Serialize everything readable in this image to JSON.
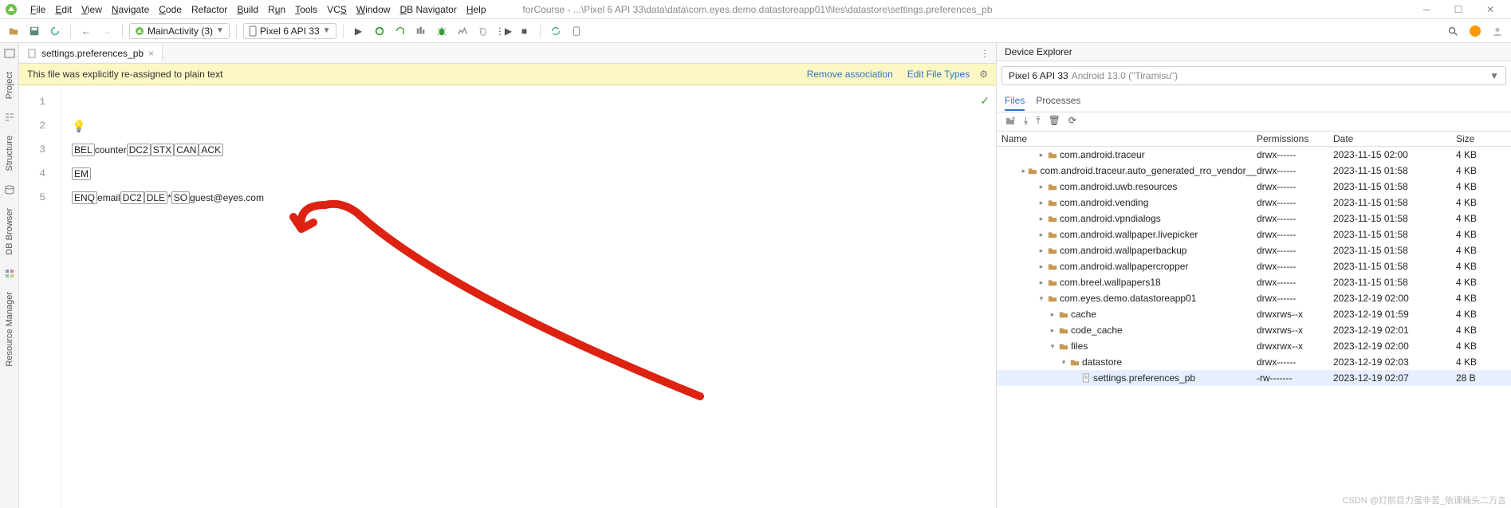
{
  "window": {
    "title_path": "forCourse - ...\\Pixel 6 API 33\\data\\data\\com.eyes.demo.datastoreapp01\\files\\datastore\\settings.preferences_pb"
  },
  "menu": {
    "file": "File",
    "edit": "Edit",
    "view": "View",
    "navigate": "Navigate",
    "code": "Code",
    "refactor": "Refactor",
    "build": "Build",
    "run": "Run",
    "tools": "Tools",
    "vcs": "VCS",
    "window": "Window",
    "dbnav": "DB Navigator",
    "help": "Help"
  },
  "toolbar": {
    "config": "MainActivity (3)",
    "device": "Pixel 6 API 33"
  },
  "left_tabs": [
    "Project",
    "Structure",
    "DB Browser",
    "Resource Manager"
  ],
  "editor": {
    "tab": "settings.preferences_pb",
    "banner_msg": "This file was explicitly re-assigned to plain text",
    "banner_remove": "Remove association",
    "banner_edit": "Edit File Types",
    "lines": [
      "1",
      "2",
      "3",
      "4",
      "5"
    ],
    "l3": {
      "a": "BEL",
      "b": "counter",
      "c": "DC2",
      "d": "STX",
      "e": "CAN",
      "f": "ACK"
    },
    "l4": {
      "a": "EM"
    },
    "l5": {
      "a": "ENQ",
      "b": "email",
      "c": "DC2",
      "d": "DLE",
      "e": "*",
      "f": "SO",
      "g": "guest@eyes.com"
    }
  },
  "device_explorer": {
    "title": "Device Explorer",
    "device": "Pixel 6 API 33",
    "device_meta": "Android 13.0 (\"Tiramisu\")",
    "tabs": {
      "files": "Files",
      "processes": "Processes"
    },
    "head": {
      "name": "Name",
      "perm": "Permissions",
      "date": "Date",
      "size": "Size"
    },
    "rows": [
      {
        "indent": 3,
        "tw": "▸",
        "icon": "folder",
        "name": "com.android.traceur",
        "perm": "drwx------",
        "date": "2023-11-15 02:00",
        "size": "4 KB"
      },
      {
        "indent": 3,
        "tw": "▸",
        "icon": "folder",
        "name": "com.android.traceur.auto_generated_rro_vendor__",
        "perm": "drwx------",
        "date": "2023-11-15 01:58",
        "size": "4 KB"
      },
      {
        "indent": 3,
        "tw": "▸",
        "icon": "folder",
        "name": "com.android.uwb.resources",
        "perm": "drwx------",
        "date": "2023-11-15 01:58",
        "size": "4 KB"
      },
      {
        "indent": 3,
        "tw": "▸",
        "icon": "folder",
        "name": "com.android.vending",
        "perm": "drwx------",
        "date": "2023-11-15 01:58",
        "size": "4 KB"
      },
      {
        "indent": 3,
        "tw": "▸",
        "icon": "folder",
        "name": "com.android.vpndialogs",
        "perm": "drwx------",
        "date": "2023-11-15 01:58",
        "size": "4 KB"
      },
      {
        "indent": 3,
        "tw": "▸",
        "icon": "folder",
        "name": "com.android.wallpaper.livepicker",
        "perm": "drwx------",
        "date": "2023-11-15 01:58",
        "size": "4 KB"
      },
      {
        "indent": 3,
        "tw": "▸",
        "icon": "folder",
        "name": "com.android.wallpaperbackup",
        "perm": "drwx------",
        "date": "2023-11-15 01:58",
        "size": "4 KB"
      },
      {
        "indent": 3,
        "tw": "▸",
        "icon": "folder",
        "name": "com.android.wallpapercropper",
        "perm": "drwx------",
        "date": "2023-11-15 01:58",
        "size": "4 KB"
      },
      {
        "indent": 3,
        "tw": "▸",
        "icon": "folder",
        "name": "com.breel.wallpapers18",
        "perm": "drwx------",
        "date": "2023-11-15 01:58",
        "size": "4 KB"
      },
      {
        "indent": 3,
        "tw": "▾",
        "icon": "folder",
        "name": "com.eyes.demo.datastoreapp01",
        "perm": "drwx------",
        "date": "2023-12-19 02:00",
        "size": "4 KB"
      },
      {
        "indent": 4,
        "tw": "▸",
        "icon": "folder",
        "name": "cache",
        "perm": "drwxrws--x",
        "date": "2023-12-19 01:59",
        "size": "4 KB"
      },
      {
        "indent": 4,
        "tw": "▸",
        "icon": "folder",
        "name": "code_cache",
        "perm": "drwxrws--x",
        "date": "2023-12-19 02:01",
        "size": "4 KB"
      },
      {
        "indent": 4,
        "tw": "▾",
        "icon": "folder",
        "name": "files",
        "perm": "drwxrwx--x",
        "date": "2023-12-19 02:00",
        "size": "4 KB"
      },
      {
        "indent": 5,
        "tw": "▾",
        "icon": "folder",
        "name": "datastore",
        "perm": "drwx------",
        "date": "2023-12-19 02:03",
        "size": "4 KB"
      },
      {
        "indent": 6,
        "tw": "",
        "icon": "file",
        "name": "settings.preferences_pb",
        "perm": "-rw-------",
        "date": "2023-12-19 02:07",
        "size": "28 B",
        "sel": true
      }
    ]
  },
  "watermark": "CSDN @灯前目力虽非苦_依课蝇头二万言"
}
